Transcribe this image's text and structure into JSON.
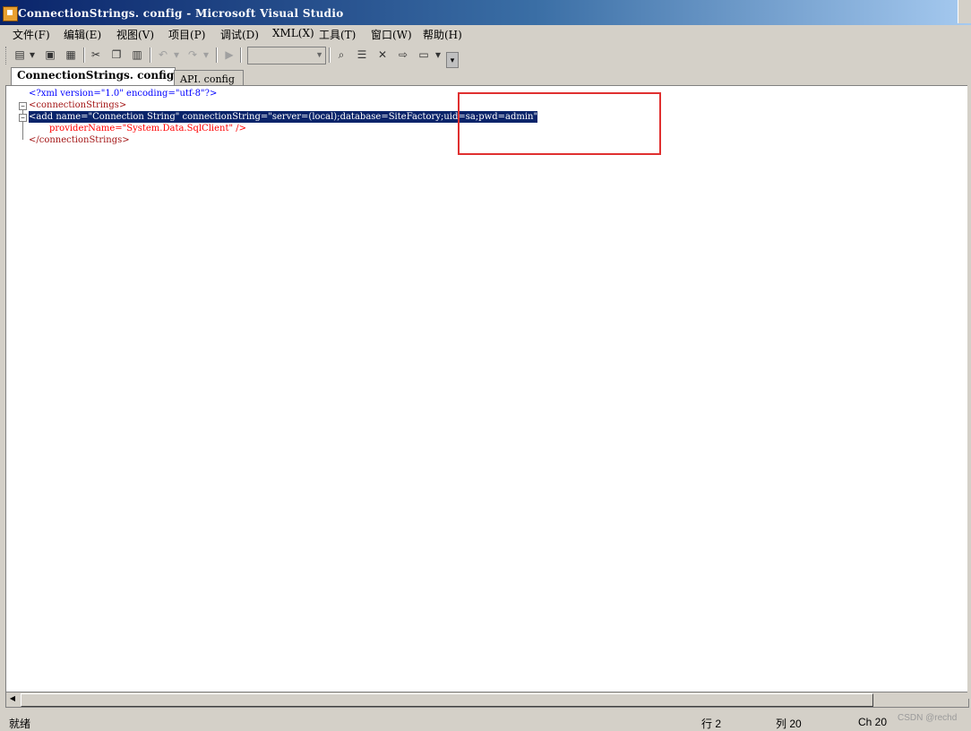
{
  "window": {
    "title": "ConnectionStrings. config - Microsoft Visual Studio"
  },
  "menu": {
    "items": [
      "文件(F)",
      "编辑(E)",
      "视图(V)",
      "项目(P)",
      "调试(D)",
      "XML(X)",
      "工具(T)",
      "窗口(W)",
      "帮助(H)"
    ]
  },
  "toolbar": {
    "icons": [
      "new-project-icon",
      "save-icon",
      "save-all-icon",
      "cut-icon",
      "copy-icon",
      "paste-icon",
      "undo-icon",
      "redo-icon",
      "start-icon",
      "find-icon",
      "properties-icon",
      "tools-icon",
      "object-browser-icon",
      "command-window-icon"
    ],
    "config_combo_value": ""
  },
  "tabs": [
    {
      "label": "ConnectionStrings. config",
      "active": true
    },
    {
      "label": "API. config",
      "active": false
    }
  ],
  "editor": {
    "line1": "<?xml version=\"1.0\" encoding=\"utf-8\"?>",
    "line2": "<connectionStrings>",
    "line3": "<add name=\"Connection String\" connectionString=\"server=(local);database=SiteFactory;uid=sa;pwd=admin\"",
    "line4": "providerName=\"System.Data.SqlClient\" />",
    "line5": "</connectionStrings>"
  },
  "status": {
    "ready": "就绪",
    "line": "行 2",
    "column": "列 20",
    "char": "Ch 20"
  },
  "watermark": "CSDN @rechd",
  "colors": {
    "selection": "#0a246a",
    "annotation_box": "#e03030",
    "titlebar_start": "#0a246a",
    "titlebar_end": "#a6caf0"
  }
}
